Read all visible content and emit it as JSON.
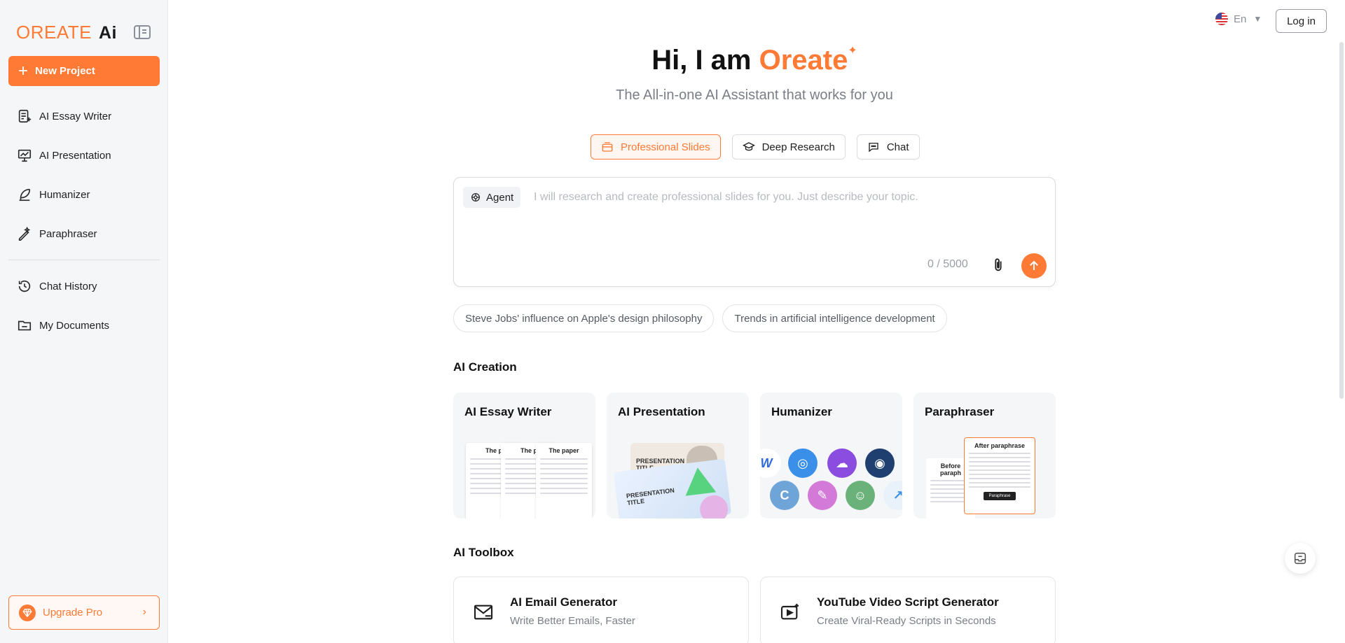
{
  "sidebar": {
    "logo_main": "OREATE",
    "logo_ai": "Ai",
    "new_project": "New Project",
    "items": [
      {
        "label": "AI Essay Writer"
      },
      {
        "label": "AI Presentation"
      },
      {
        "label": "Humanizer"
      },
      {
        "label": "Paraphraser"
      },
      {
        "label": "Chat History"
      },
      {
        "label": "My Documents"
      }
    ],
    "upgrade": "Upgrade Pro"
  },
  "topbar": {
    "language": "En",
    "login": "Log in"
  },
  "hero": {
    "title_prefix": "Hi, I am ",
    "title_brand": "Oreate",
    "spark": "✦",
    "subtitle": "The All-in-one AI Assistant that works for you"
  },
  "modes": [
    {
      "label": "Professional Slides",
      "active": true
    },
    {
      "label": "Deep Research",
      "active": false
    },
    {
      "label": "Chat",
      "active": false
    }
  ],
  "prompt": {
    "agent_label": "Agent",
    "placeholder": "I will research and create professional slides for you. Just describe your topic.",
    "counter": "0 / 5000"
  },
  "suggestions": [
    "Steve Jobs' influence on Apple's design philosophy",
    "Trends in artificial intelligence development"
  ],
  "ai_creation": {
    "heading": "AI Creation",
    "cards": [
      {
        "title": "AI Essay Writer",
        "paper_titles": [
          "The p",
          "The p",
          "The paper"
        ]
      },
      {
        "title": "AI Presentation",
        "slide_title_1": "PRESENTATION TITLE",
        "slide_title_2": "PRESENTATION TITLE"
      },
      {
        "title": "Humanizer",
        "icon_letters": [
          "W",
          "C"
        ]
      },
      {
        "title": "Paraphraser",
        "before_label": "Before paraph",
        "after_label": "After paraphrase",
        "button_label": "Paraphrase"
      }
    ]
  },
  "ai_toolbox": {
    "heading": "AI Toolbox",
    "tools": [
      {
        "name": "AI Email Generator",
        "desc": "Write Better Emails, Faster"
      },
      {
        "name": "YouTube Video Script Generator",
        "desc": "Create Viral-Ready Scripts in Seconds"
      }
    ]
  },
  "colors": {
    "accent": "#ff7a35",
    "sidebar_bg": "#f5f6f8"
  }
}
